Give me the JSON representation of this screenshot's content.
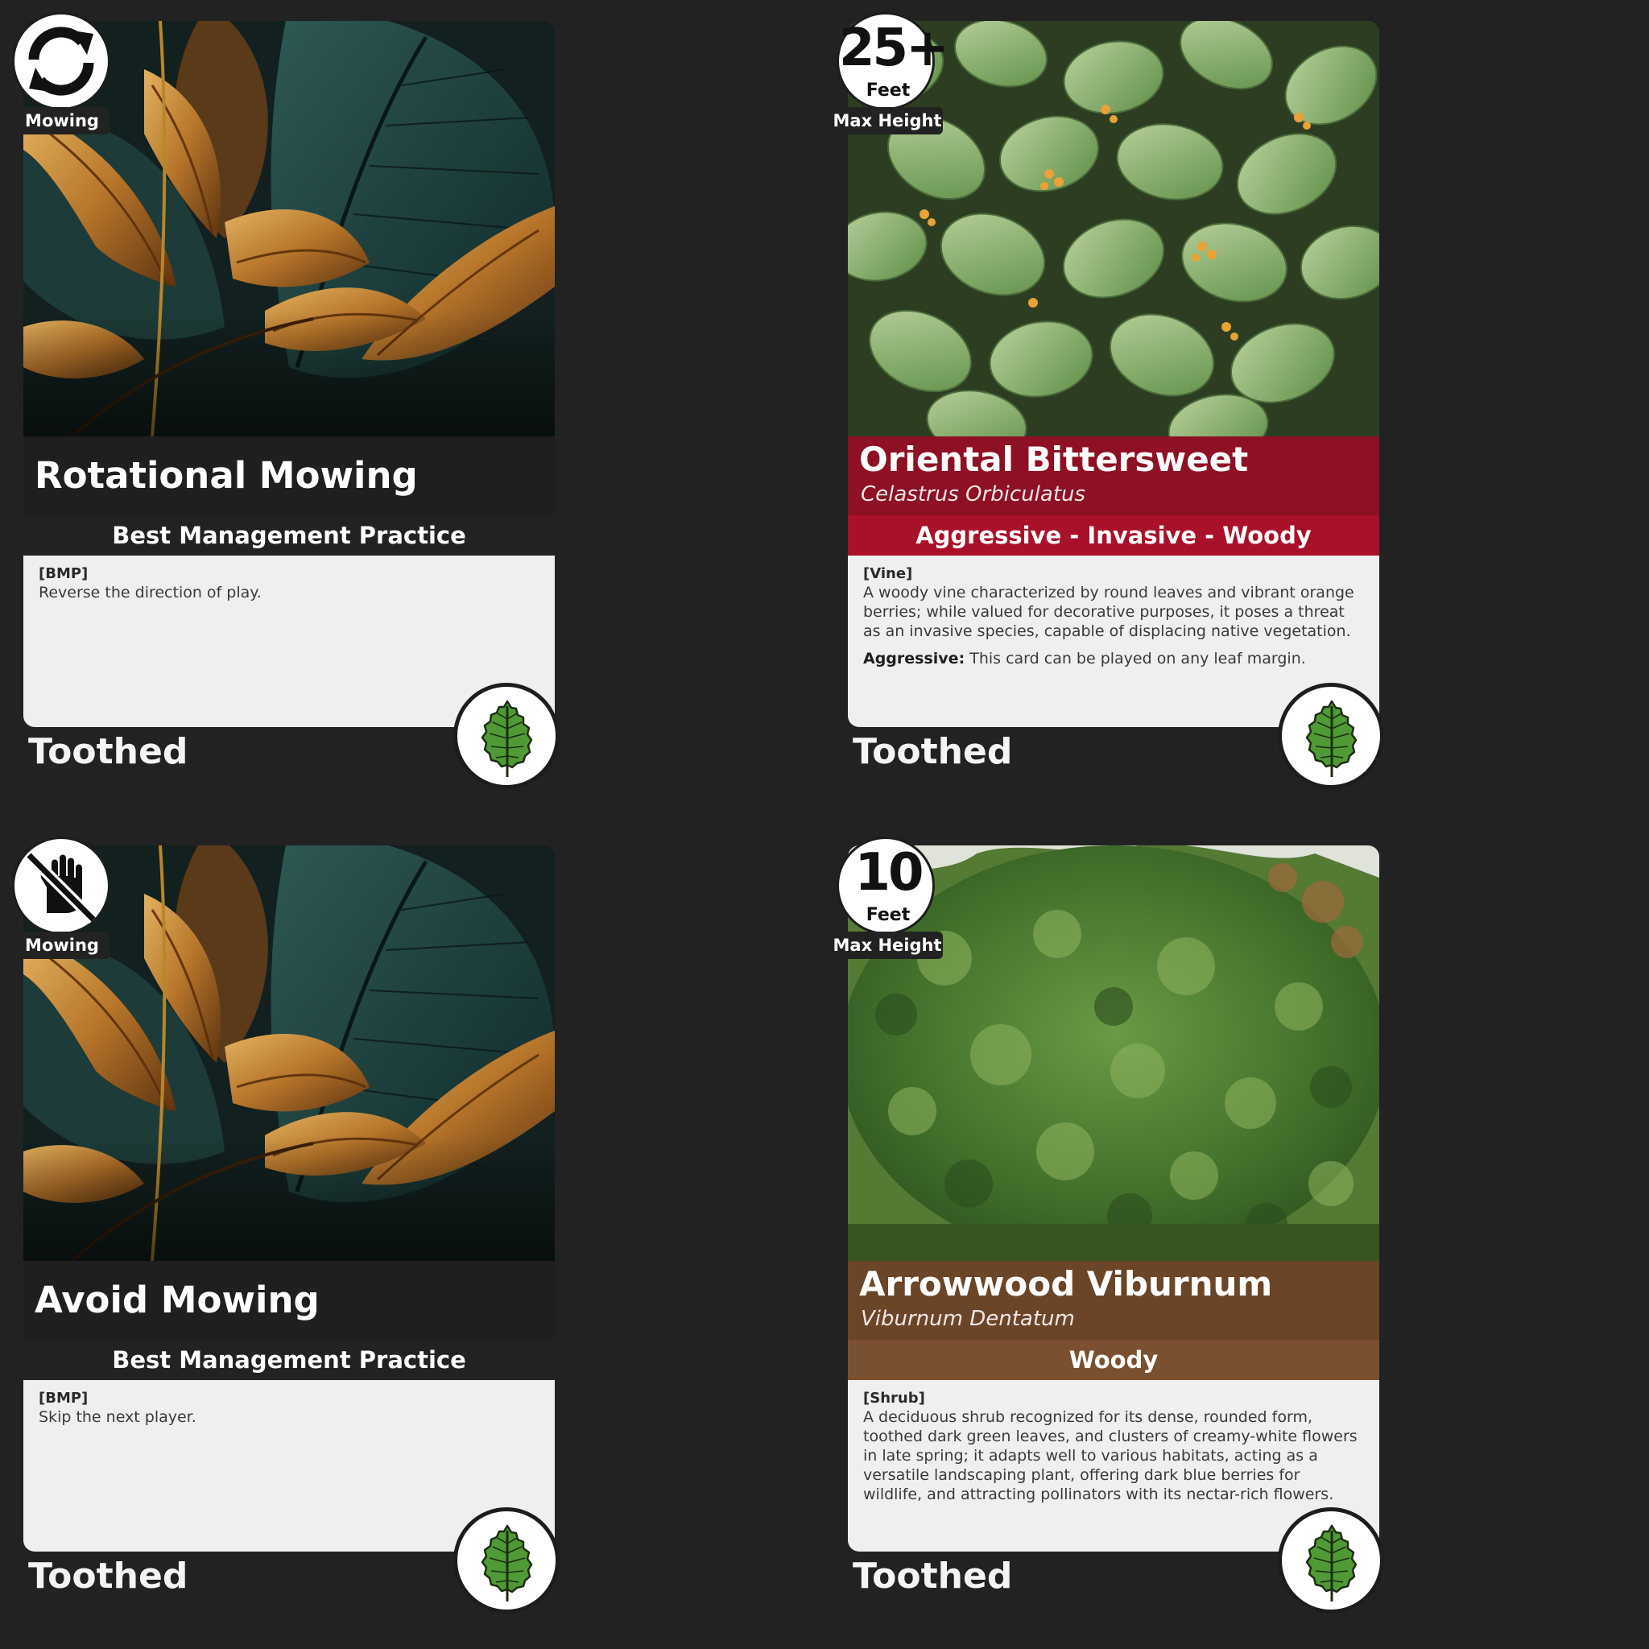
{
  "cards": [
    {
      "type": "bmp",
      "corner_icon": "rotate-arrows-icon",
      "corner_label": "Mowing",
      "title": "Rotational Mowing",
      "subtitle": "Best Management Practice",
      "tag": "[BMP]",
      "body": "Reverse the direction of play.",
      "margin": "Toothed"
    },
    {
      "type": "plant",
      "max_height_value": "25+",
      "max_height_unit": "Feet",
      "max_height_label": "Max Height",
      "title": "Oriental Bittersweet",
      "scientific_name": "Celastrus Orbiculatus",
      "subtitle": "Aggressive - Invasive - Woody",
      "tag": "[Vine]",
      "body": "A woody vine characterized by round leaves and vibrant orange berries; while valued for decorative purposes, it poses a threat as an invasive species, capable of displacing native vegetation.",
      "keyword": "Aggressive:",
      "keyword_text": " This card can be played on any leaf margin.",
      "band_color": "#8e1024",
      "margin": "Toothed"
    },
    {
      "type": "bmp",
      "corner_icon": "no-hand-icon",
      "corner_label": "Mowing",
      "title": "Avoid Mowing",
      "subtitle": "Best Management Practice",
      "tag": "[BMP]",
      "body": "Skip the next player.",
      "margin": "Toothed"
    },
    {
      "type": "plant",
      "max_height_value": "10",
      "max_height_unit": "Feet",
      "max_height_label": "Max Height",
      "title": "Arrowwood Viburnum",
      "scientific_name": "Viburnum Dentatum",
      "subtitle": "Woody",
      "tag": "[Shrub]",
      "body": "A deciduous shrub recognized for its dense, rounded form, toothed dark green leaves, and clusters of creamy-white flowers in late spring; it adapts well to various habitats, acting as a versatile landscaping plant, offering dark blue berries for wildlife, and attracting pollinators with its nectar-rich flowers.",
      "band_color": "#6b4528",
      "margin": "Toothed"
    }
  ],
  "colors": {
    "background": "#222222",
    "text_panel": "#efefef",
    "invasive_band": "#8e1024",
    "native_band": "#6b4528",
    "bmp_band": "#1f1f1f"
  }
}
